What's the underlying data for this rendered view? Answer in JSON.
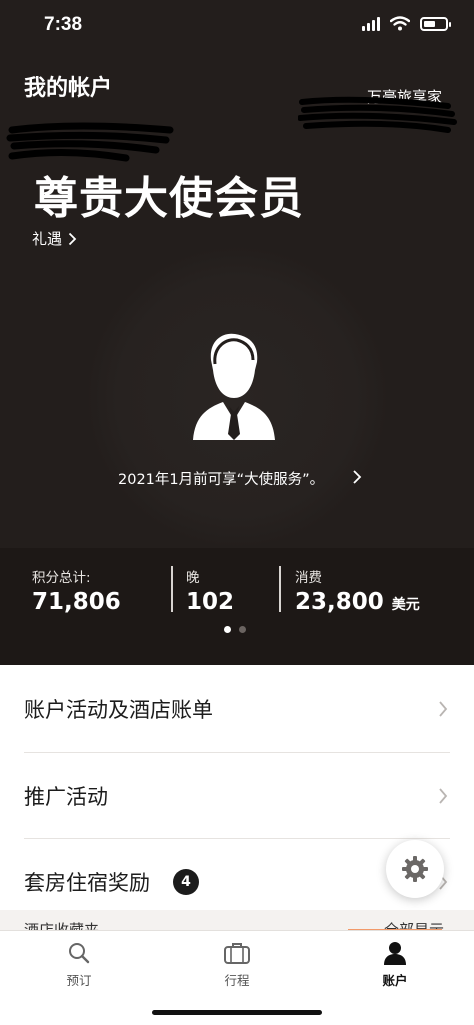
{
  "status_bar": {
    "time": "7:38"
  },
  "header": {
    "title": "我的帐户",
    "program_name": "万豪旅享家"
  },
  "member": {
    "tier": "尊贵大使会员",
    "benefits_link": "礼遇",
    "ambassador_note": "2021年1月前可享“大使服务”。"
  },
  "stats": [
    {
      "label": "积分总计:",
      "value": "71,806",
      "unit": ""
    },
    {
      "label": "晚",
      "value": "102",
      "unit": ""
    },
    {
      "label": "消费",
      "value": "23,800",
      "unit": "美元"
    }
  ],
  "pager": {
    "pages": 2,
    "active": 1
  },
  "menu": {
    "account_activity": "账户活动及酒店账单",
    "promotions": "推广活动",
    "suite_rewards": "套房住宿奖励",
    "suite_rewards_badge": "4"
  },
  "partial_section": {
    "label": "酒店收藏夹",
    "action": "全部显示"
  },
  "tabs": [
    {
      "label": "预订",
      "icon": "search-icon",
      "active": false
    },
    {
      "label": "行程",
      "icon": "suitcase-icon",
      "active": false
    },
    {
      "label": "账户",
      "icon": "person-icon",
      "active": true
    }
  ],
  "colors": {
    "dark_bg": "#231e1c",
    "stats_bg": "#1d1816",
    "accent_underline": "#f29a6a"
  }
}
